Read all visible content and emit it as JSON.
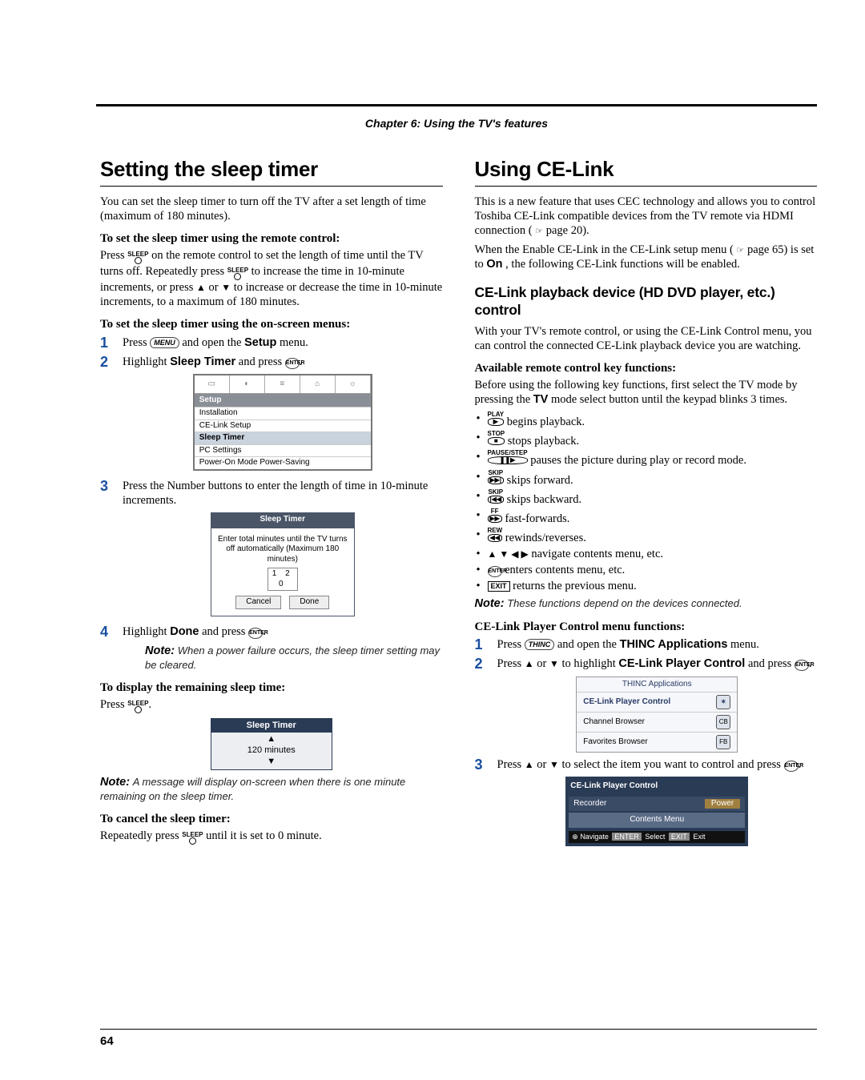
{
  "chapter_banner": "Chapter 6: Using the TV's features",
  "page_number": "64",
  "left": {
    "h1": "Setting the sleep timer",
    "intro": "You can set the sleep timer to turn off the TV after a set length of time (maximum of 180 minutes).",
    "sub1_title": "To set the sleep timer using the remote control:",
    "sub1_body_a": "Press ",
    "sub1_body_b": " on the remote control to set the length of time until the TV turns off. Repeatedly press ",
    "sub1_body_c": " to increase the time in 10-minute increments, or press ",
    "sub1_body_d": " to increase or decrease the time in 10-minute increments, to a maximum of 180 minutes.",
    "sub2_title": "To set the sleep timer using the on-screen menus:",
    "step1_a": "Press ",
    "step1_b": " and open the ",
    "step1_c": " menu.",
    "step1_bold": "Setup",
    "step2_a": "Highlight ",
    "step2_bold": "Sleep Timer",
    "step2_b": " and press ",
    "step3": "Press the Number buttons to enter the length of time in 10-minute increments.",
    "step4_a": "Highlight ",
    "step4_bold": "Done",
    "step4_b": " and press ",
    "note1_label": "Note:",
    "note1_body": " When a power failure occurs, the sleep timer setting may be cleared.",
    "display_title": "To display the remaining sleep time:",
    "display_body": "Press ",
    "note2_label": "Note:",
    "note2_body": " A message will display on-screen when there is one minute remaining on the sleep timer.",
    "cancel_title": "To cancel the sleep timer:",
    "cancel_body_a": "Repeatedly press ",
    "cancel_body_b": " until it is set to 0 minute.",
    "panel_setup": {
      "header": "Setup",
      "rows": [
        "Installation",
        "CE-Link Setup",
        "Sleep Timer",
        "PC Settings",
        "Power-On Mode   Power-Saving"
      ],
      "selected_index": 2
    },
    "panel_sleep_entry": {
      "title": "Sleep Timer",
      "msg": "Enter total minutes until the TV turns off automatically (Maximum 180 minutes)",
      "digits": "1 2 0",
      "cancel": "Cancel",
      "done": "Done"
    },
    "panel_remaining": {
      "title": "Sleep Timer",
      "value": "120 minutes"
    }
  },
  "right": {
    "h1": "Using CE-Link",
    "intro_a": "This is a new feature that uses CEC technology and allows you to control Toshiba CE-Link compatible devices from the TV remote via HDMI connection (",
    "intro_b": " page 20).",
    "intro2_a": "When the Enable CE-Link in the CE-Link setup menu (",
    "intro2_b": " page 65) is set to ",
    "intro2_on": "On",
    "intro2_c": ", the following CE-Link functions will be enabled.",
    "h2": "CE-Link playback device (HD DVD player, etc.) control",
    "h2_body": "With your TV's remote control, or using the CE-Link Control menu, you can control the connected CE-Link playback device you are watching.",
    "avail_title": "Available remote control key functions:",
    "avail_body_a": "Before using the following key functions, first select the TV mode by pressing the ",
    "avail_tv": "TV",
    "avail_body_b": " mode select button until the keypad blinks 3 times.",
    "bullets": {
      "play_label": "PLAY",
      "play": " begins playback.",
      "stop_label": "STOP",
      "stop": " stops playback.",
      "pause_label": "PAUSE/STEP",
      "pause": " pauses the picture during play or record mode.",
      "skipf_label": "SKIP",
      "skipf": " skips forward.",
      "skipb_label": "SKIP",
      "skipb": " skips backward.",
      "ff_label": "FF",
      "ff": " fast-forwards.",
      "rew_label": "REW",
      "rew": " rewinds/reverses.",
      "nav": " navigate contents menu, etc.",
      "enter": " enters contents menu, etc.",
      "exit": " returns the previous menu."
    },
    "note3_label": "Note:",
    "note3_body": " These functions depend on the devices connected.",
    "player_title": "CE-Link Player Control menu functions:",
    "pstep1_a": "Press ",
    "pstep1_b": " and open the ",
    "pstep1_bold": "THINC Applications",
    "pstep1_c": " menu.",
    "pstep2_a": "Press ",
    "pstep2_b": " to highlight ",
    "pstep2_bold": "CE-Link Player Control",
    "pstep2_c": " and press ",
    "pstep3_a": "Press ",
    "pstep3_b": " to select the item you want to control and press ",
    "panel_thinc": {
      "title": "THINC Applications",
      "rows": [
        "CE-Link Player Control",
        "Channel Browser",
        "Favorites Browser"
      ],
      "badges": [
        "✶",
        "CB",
        "FB"
      ]
    },
    "panel_player": {
      "title": "CE-Link Player Control",
      "row_label": "Recorder",
      "row_val": "Power",
      "contents": "Contents Menu",
      "nav": "Navigate",
      "sel": "Select",
      "exit": "Exit",
      "enter_tag": "ENTER",
      "exit_tag": "EXIT"
    }
  }
}
